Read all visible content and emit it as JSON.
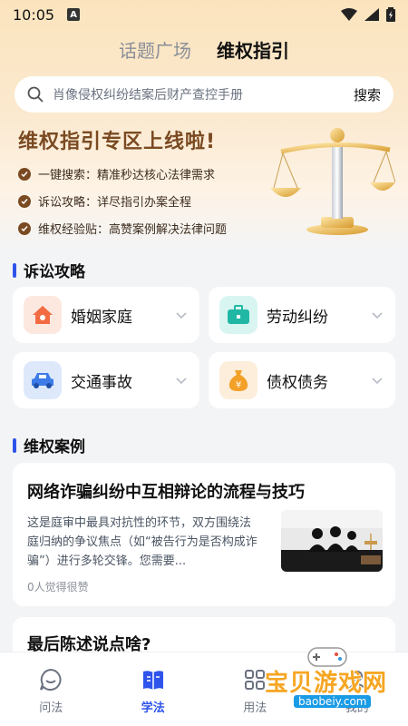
{
  "statusbar": {
    "time": "10:05",
    "a_badge": "A"
  },
  "top_tabs": [
    {
      "label": "话题广场",
      "active": false
    },
    {
      "label": "维权指引",
      "active": true
    }
  ],
  "search": {
    "placeholder": "肖像侵权纠纷结案后财产查控手册",
    "button": "搜索"
  },
  "hero": {
    "title": "维权指引专区上线啦!",
    "features": [
      "一键搜索：精准秒达核心法律需求",
      "诉讼攻略：详尽指引办案全程",
      "维权经验贴：高赞案例解决法律问题"
    ],
    "illustration": "scales-of-justice"
  },
  "litigation_guide": {
    "title": "诉讼攻略",
    "categories": [
      {
        "label": "婚姻家庭",
        "icon": "house-icon",
        "icon_bg": "#fde8e0",
        "icon_color": "#f36b42"
      },
      {
        "label": "劳动纠纷",
        "icon": "briefcase-icon",
        "icon_bg": "#d9f5f1",
        "icon_color": "#20b8a5"
      },
      {
        "label": "交通事故",
        "icon": "car-icon",
        "icon_bg": "#dde9fb",
        "icon_color": "#3c7be8"
      },
      {
        "label": "债权债务",
        "icon": "money-bag-icon",
        "icon_bg": "#fdeedb",
        "icon_color": "#f3a028"
      }
    ]
  },
  "cases": {
    "title": "维权案例",
    "items": [
      {
        "title": "网络诈骗纠纷中互相辩论的流程与技巧",
        "summary": "这是庭审中最具对抗性的环节，双方围绕法庭归纳的争议焦点（如“被告行为是否构成诈骗”）进行多轮交锋。您需要...",
        "likes": "0人觉得很赞"
      },
      {
        "title": "最后陈述说点啥?"
      }
    ]
  },
  "bottom_nav": [
    {
      "label": "问法",
      "icon": "chat-bubble-icon",
      "active": false
    },
    {
      "label": "学法",
      "icon": "book-icon",
      "active": true
    },
    {
      "label": "用法",
      "icon": "tools-icon",
      "active": false
    },
    {
      "label": "我的",
      "icon": "user-icon",
      "active": false
    }
  ],
  "watermark": {
    "text": "宝贝游戏网",
    "url": "baobeiy.com"
  },
  "colors": {
    "accent": "#2f54eb",
    "hero_brown": "#7a4a22"
  }
}
